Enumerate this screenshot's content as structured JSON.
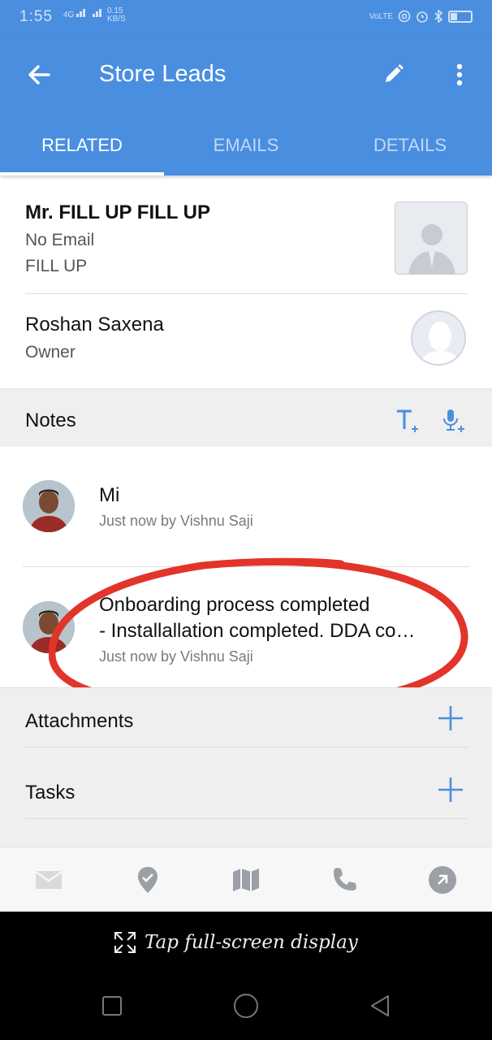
{
  "status_bar": {
    "time": "1:55",
    "network": "4G",
    "speed_value": "0.15",
    "speed_unit": "KB/S",
    "volte": "VoLTE"
  },
  "app_bar": {
    "title": "Store Leads",
    "back_icon": "arrow-left-icon",
    "edit_icon": "pencil-icon",
    "more_icon": "more-vert-icon"
  },
  "tabs": [
    {
      "label": "RELATED",
      "active": true
    },
    {
      "label": "EMAILS",
      "active": false
    },
    {
      "label": "DETAILS",
      "active": false
    }
  ],
  "contact": {
    "name": "Mr. FILL UP FILL UP",
    "email": "No Email",
    "company": "FILL UP"
  },
  "owner": {
    "name": "Roshan Saxena",
    "role": "Owner"
  },
  "notes": {
    "label": "Notes",
    "items": [
      {
        "title": "Mi",
        "meta": "Just now by Vishnu Saji"
      },
      {
        "title": "Onboarding process completed",
        "title_line2": "- Installallation completed. DDA co…",
        "meta": "Just now by Vishnu Saji"
      }
    ]
  },
  "attachments": {
    "label": "Attachments"
  },
  "tasks": {
    "label": "Tasks"
  },
  "bottom_nav": [
    "mail-icon",
    "checkin-icon",
    "map-icon",
    "phone-icon",
    "open-external-icon"
  ],
  "fullscreen_prompt": "Tap full-screen display",
  "colors": {
    "primary": "#4a8ee0",
    "accent_icon": "#4a8ee0",
    "annotation": "#e3342a"
  }
}
